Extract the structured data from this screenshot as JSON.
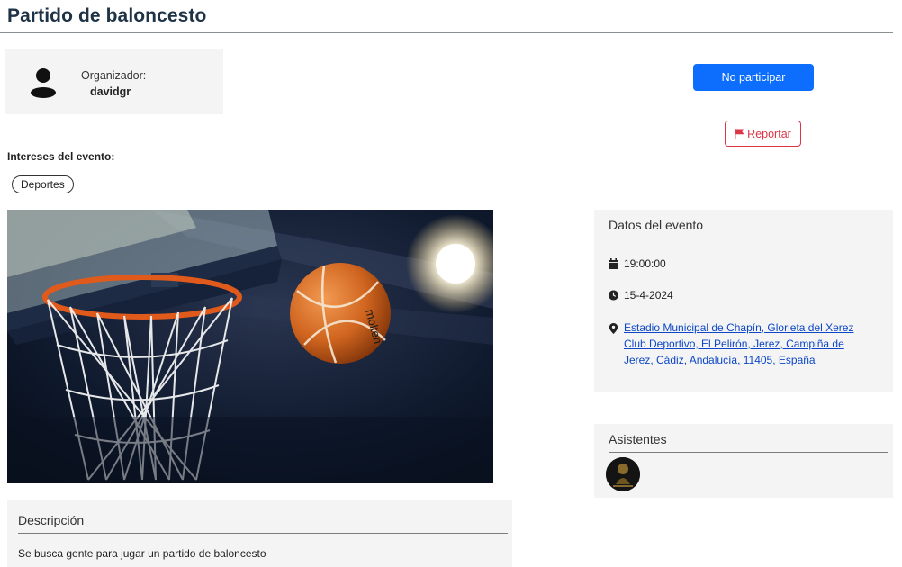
{
  "page": {
    "title": "Partido de baloncesto"
  },
  "organizer": {
    "label": "Organizador:",
    "name": "davidgr",
    "icon": "user-icon"
  },
  "actions": {
    "leave_label": "No participar",
    "report_label": "Reportar",
    "report_icon": "flag-icon",
    "primary_color": "#0d6efd",
    "danger_color": "#dc3545"
  },
  "interests": {
    "label": "Intereses del evento:",
    "tags": [
      "Deportes"
    ]
  },
  "image": {
    "subject": "basketball-hoop-photo"
  },
  "description": {
    "title": "Descripción",
    "text": "Se busca gente para jugar un partido de baloncesto"
  },
  "event_data": {
    "title": "Datos del evento",
    "time": "19:00:00",
    "time_icon": "calendar-icon",
    "date": "15-4-2024",
    "date_icon": "clock-icon",
    "location": "Estadio Municipal de Chapín, Glorieta del Xerez Club Deportivo, El Pelirón, Jerez, Campiña de Jerez, Cádiz, Andalucía, 11405, España",
    "location_icon": "map-marker-icon"
  },
  "attendees": {
    "title": "Asistentes",
    "count_avatars": 1
  }
}
